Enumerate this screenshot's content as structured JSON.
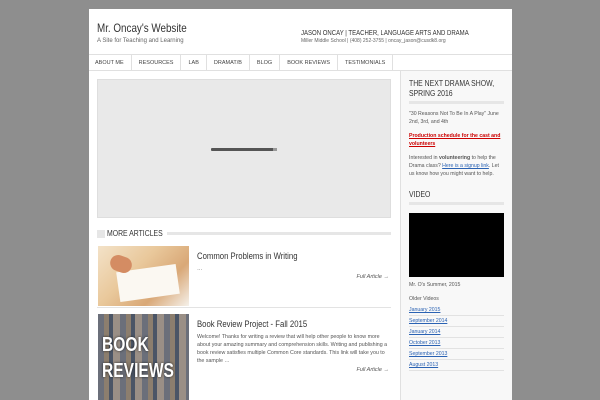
{
  "site": {
    "title": "Mr. Oncay's Website",
    "tagline": "A Site for Teaching and Learning",
    "owner": "JASON ONCAY | TEACHER, LANGUAGE ARTS AND DRAMA",
    "contact": "Miller Middle School | (408) 252-3755 | oncay_jason@cusdk8.org"
  },
  "nav": [
    "ABOUT ME",
    "RESOURCES",
    "LAB",
    "DRAMAT/B",
    "BLOG",
    "BOOK REVIEWS",
    "TESTIMONIALS"
  ],
  "main": {
    "more_articles_label": "MORE ARTICLES",
    "articles": [
      {
        "title": "Common Problems in Writing",
        "excerpt": "…",
        "more": "Full Article →"
      },
      {
        "title": "Book Review Project - Fall 2015",
        "excerpt": "Welcome!  Thanks for writing a review that will help other people to know more about your amazing summary and comprehension skills.  Writing and publishing a book review satisfies multiple Common Core standards.  This link will take you to the sample …",
        "more": "Full Article →",
        "thumb_text": [
          "BOOK",
          "REVIEWS"
        ]
      }
    ]
  },
  "sidebar": {
    "drama": {
      "title": "THE NEXT DRAMA SHOW, SPRING 2016",
      "line1": "\"30 Reasons Not To Be In A Play\" June 2nd, 3rd, and 4th",
      "schedule_link": "Production schedule for the cast and volunteers",
      "interest_pre": "Interested in ",
      "interest_bold": "volunteering",
      "interest_mid": " to help the Drama class? ",
      "signup_link": "Here is a signup link",
      "interest_post": ". Let us know how you might want to help."
    },
    "video": {
      "title": "VIDEO",
      "caption": "Mr. O's Summer, 2015",
      "older_label": "Older Videos",
      "older": [
        "January 2015",
        "September 2014",
        "January 2014",
        "October 2013",
        "September 2013",
        "August 2013"
      ]
    }
  }
}
